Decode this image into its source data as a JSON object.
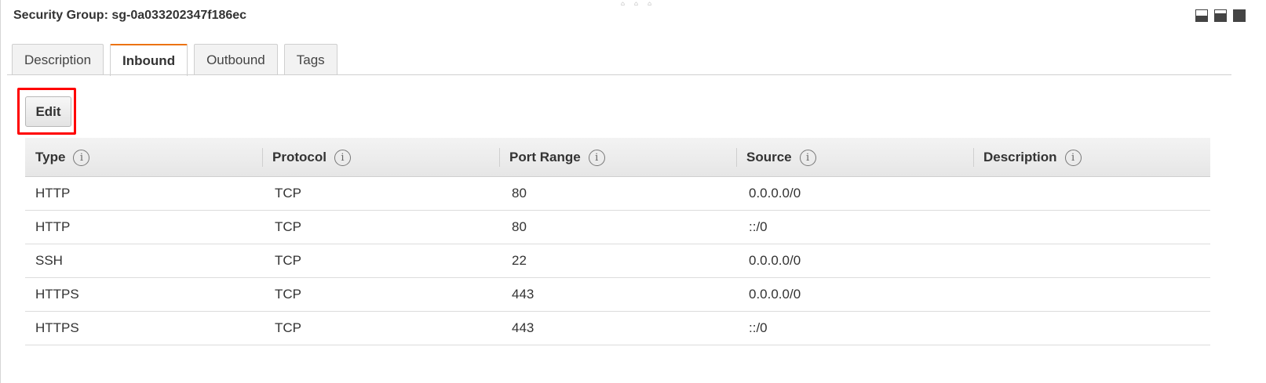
{
  "panel": {
    "title": "Security Group: sg-0a033202347f186ec",
    "drag_handle": "⌂ ⌂ ⌂"
  },
  "window_controls": [
    {
      "name": "minimize-panel-icon"
    },
    {
      "name": "half-panel-icon"
    },
    {
      "name": "maximize-panel-icon"
    }
  ],
  "tabs": [
    {
      "label": "Description",
      "active": false
    },
    {
      "label": "Inbound",
      "active": true
    },
    {
      "label": "Outbound",
      "active": false
    },
    {
      "label": "Tags",
      "active": false
    }
  ],
  "toolbar": {
    "edit_label": "Edit",
    "highlight_color": "#ff0000"
  },
  "table": {
    "columns": [
      {
        "label": "Type",
        "info_icon": "i"
      },
      {
        "label": "Protocol",
        "info_icon": "i"
      },
      {
        "label": "Port Range",
        "info_icon": "i"
      },
      {
        "label": "Source",
        "info_icon": "i"
      },
      {
        "label": "Description",
        "info_icon": "i"
      }
    ],
    "rows": [
      [
        "HTTP",
        "TCP",
        "80",
        "0.0.0.0/0",
        ""
      ],
      [
        "HTTP",
        "TCP",
        "80",
        "::/0",
        ""
      ],
      [
        "SSH",
        "TCP",
        "22",
        "0.0.0.0/0",
        ""
      ],
      [
        "HTTPS",
        "TCP",
        "443",
        "0.0.0.0/0",
        ""
      ],
      [
        "HTTPS",
        "TCP",
        "443",
        "::/0",
        ""
      ]
    ]
  },
  "colors": {
    "active_tab_accent": "#ec7211"
  }
}
